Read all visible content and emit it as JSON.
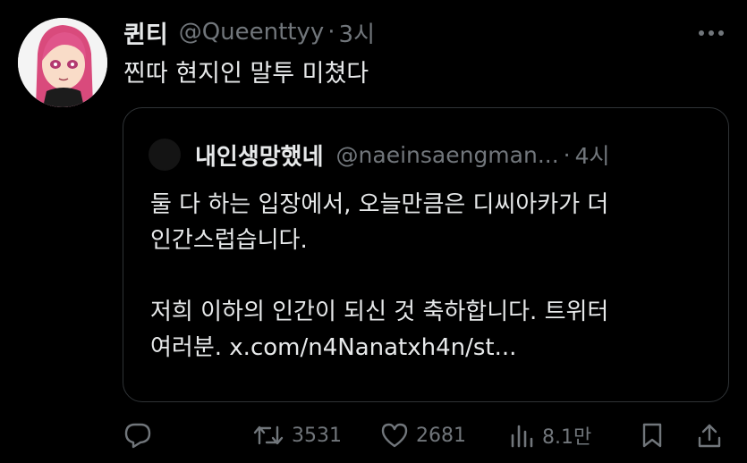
{
  "tweet": {
    "display_name": "퀸티",
    "handle": "@Queenttyy",
    "separator": "·",
    "time": "3시",
    "text": "찐따 현지인 말투 미쳤다"
  },
  "quote": {
    "display_name": "내인생망했네",
    "handle": "@naeinsaengman...",
    "separator": "·",
    "time": "4시",
    "lines": [
      "둘 다 하는 입장에서, 오늘만큼은 디씨아카가 더",
      "인간스럽습니다.",
      "저희 이하의 인간이 되신 것 축하합니다. 트위터",
      "여러분. x.com/n4Nanatxh4n/st..."
    ]
  },
  "actions": {
    "retweets": "3531",
    "likes": "2681",
    "views": "8.1만"
  },
  "icons": {
    "reply": "reply-icon",
    "retweet": "retweet-icon",
    "like": "heart-icon",
    "views": "views-icon",
    "bookmark": "bookmark-icon",
    "share": "share-icon",
    "more": "more-icon"
  },
  "colors": {
    "background": "#000000",
    "text": "#e7e9ea",
    "secondary": "#71767b",
    "border": "#2f3336"
  }
}
